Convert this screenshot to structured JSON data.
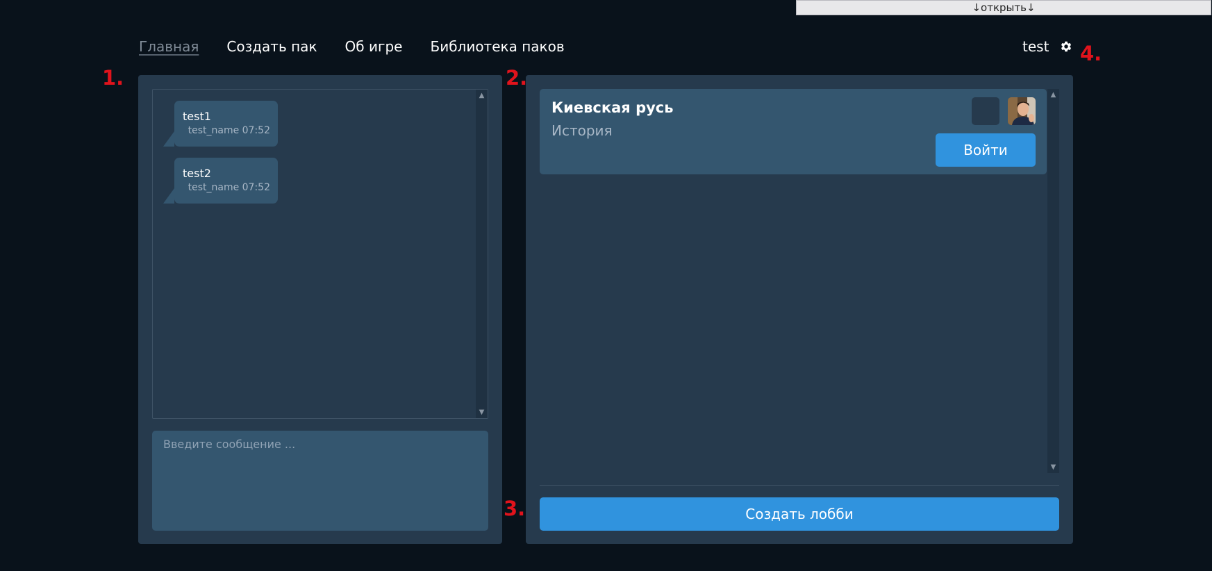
{
  "top_tab": {
    "label": "↓открыть↓"
  },
  "nav": {
    "items": [
      {
        "label": "Главная"
      },
      {
        "label": "Создать пак"
      },
      {
        "label": "Об игре"
      },
      {
        "label": "Библиотека паков"
      }
    ]
  },
  "user": {
    "name": "test"
  },
  "markers": [
    "1.",
    "2.",
    "3.",
    "4."
  ],
  "chat": {
    "messages": [
      {
        "text": "test1",
        "author": "test_name",
        "time": "07:52",
        "meta": "test_name 07:52"
      },
      {
        "text": "test2",
        "author": "test_name",
        "time": "07:52",
        "meta": "test_name 07:52"
      }
    ],
    "input_placeholder": "Введите сообщение ..."
  },
  "lobbies": [
    {
      "title": "Киевская русь",
      "subtitle": "История",
      "join_label": "Войти"
    }
  ],
  "create_lobby_label": "Создать лобби",
  "colors": {
    "background": "#09121b",
    "panel": "#263a4d",
    "card": "#34566f",
    "accent": "#3093de",
    "marker": "#e0131c"
  }
}
